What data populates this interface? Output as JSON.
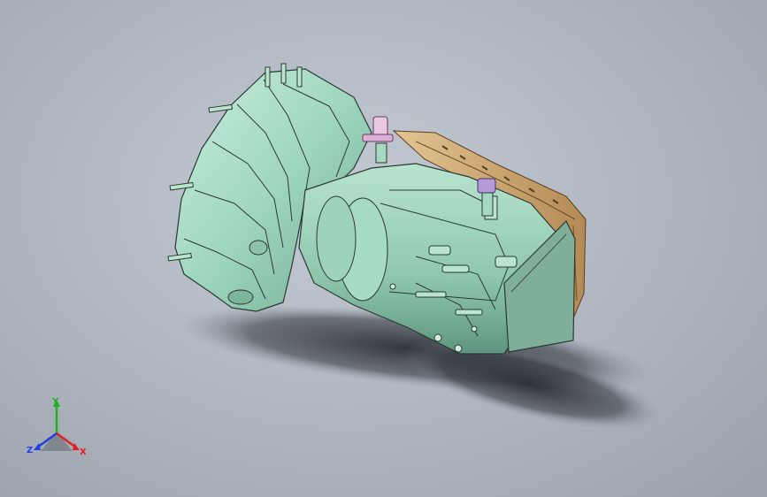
{
  "view": {
    "background_top": "#c4cad2",
    "background_bottom": "#9aa2ad",
    "model_color": "#9fd6bf",
    "pan_color": "#d4b07a"
  },
  "triad": {
    "x_label": "X",
    "y_label": "Y",
    "z_label": "Z",
    "x_color": "#e02020",
    "y_color": "#20b020",
    "z_color": "#2040e0"
  }
}
